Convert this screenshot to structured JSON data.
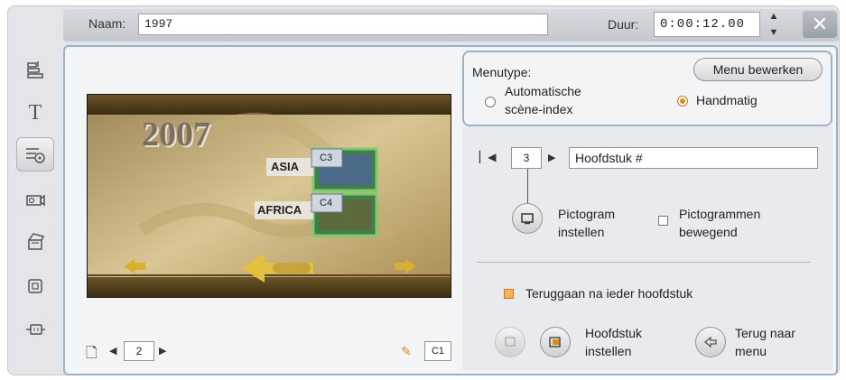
{
  "header": {
    "name_label": "Naam:",
    "name_value": "1997",
    "duration_label": "Duur:",
    "duration_value": "0:00:12.00"
  },
  "toolbar": {
    "tools": [
      {
        "icon": "layers-icon"
      },
      {
        "icon": "title-text-icon",
        "glyph": "T"
      },
      {
        "icon": "disc-menu-icon",
        "active": true
      },
      {
        "icon": "camera-icon"
      },
      {
        "icon": "transition-icon"
      },
      {
        "icon": "window-icon"
      },
      {
        "icon": "connector-icon"
      }
    ]
  },
  "preview": {
    "year_text": "2007",
    "buttons": [
      {
        "label": "ASIA",
        "chapter": "C3"
      },
      {
        "label": "AFRICA",
        "chapter": "C4"
      }
    ],
    "page_number": "2",
    "chapter_tag": "C1"
  },
  "menu_type": {
    "label": "Menutype:",
    "edit_button": "Menu bewerken",
    "options": [
      {
        "label_line1": "Automatische",
        "label_line2": "scène-index",
        "selected": false
      },
      {
        "label": "Handmatig",
        "selected": true
      }
    ]
  },
  "chapter": {
    "index": "3",
    "title_value": "Hoofdstuk #",
    "set_thumbnail_line1": "Pictogram",
    "set_thumbnail_line2": "instellen",
    "animated_line1": "Pictogrammen",
    "animated_line2": "bewegend",
    "animated_checked": false,
    "return_label": "Teruggaan na ieder hoofdstuk",
    "return_checked": true,
    "set_chapter_line1": "Hoofdstuk",
    "set_chapter_line2": "instellen",
    "back_to_menu_line1": "Terug naar",
    "back_to_menu_line2": "menu"
  }
}
